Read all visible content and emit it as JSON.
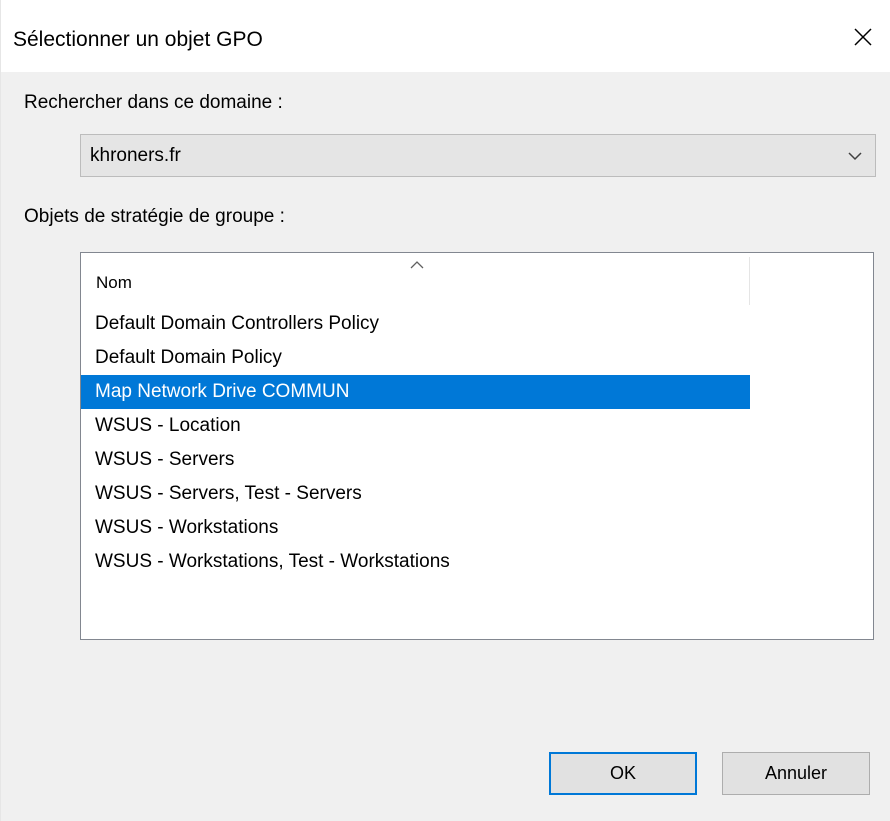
{
  "window": {
    "title": "Sélectionner un objet GPO",
    "close_icon": "close-icon"
  },
  "domain": {
    "label": "Rechercher dans ce domaine :",
    "selected": "khroners.fr",
    "dropdown_icon": "chevron-down-icon"
  },
  "gpo_list": {
    "label": "Objets de stratégie de groupe :",
    "column_header": "Nom",
    "sort_icon": "sort-ascending-icon",
    "items": [
      {
        "name": "Default Domain Controllers Policy",
        "selected": false
      },
      {
        "name": "Default Domain Policy",
        "selected": false
      },
      {
        "name": "Map Network Drive COMMUN",
        "selected": true
      },
      {
        "name": "WSUS - Location",
        "selected": false
      },
      {
        "name": "WSUS - Servers",
        "selected": false
      },
      {
        "name": "WSUS - Servers, Test - Servers",
        "selected": false
      },
      {
        "name": "WSUS - Workstations",
        "selected": false
      },
      {
        "name": "WSUS - Workstations, Test - Workstations",
        "selected": false
      }
    ]
  },
  "buttons": {
    "ok_label": "OK",
    "cancel_label": "Annuler"
  },
  "colors": {
    "selection": "#0078d7",
    "dialog_background": "#f0f0f0",
    "titlebar_background": "#ffffff"
  }
}
